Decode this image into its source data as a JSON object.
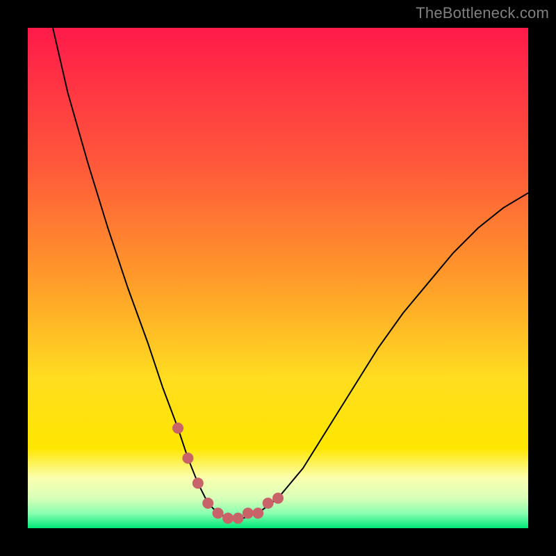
{
  "watermark": "TheBottleneck.com",
  "colors": {
    "bg_black": "#000000",
    "grad_top": "#ff1a4a",
    "grad_mid_orange": "#ff8a2a",
    "grad_yellow": "#ffe600",
    "grad_pale": "#f8ffb8",
    "grad_green": "#00e878",
    "curve": "#000000",
    "marker": "#c86469"
  },
  "chart_data": {
    "type": "line",
    "title": "",
    "xlabel": "",
    "ylabel": "",
    "xlim": [
      0,
      100
    ],
    "ylim": [
      0,
      100
    ],
    "grid": false,
    "legend": false,
    "series": [
      {
        "name": "bottleneck-curve",
        "x": [
          5,
          8,
          12,
          16,
          20,
          24,
          27,
          30,
          32,
          34,
          36,
          38,
          40,
          43,
          46,
          50,
          55,
          60,
          65,
          70,
          75,
          80,
          85,
          90,
          95,
          100
        ],
        "y": [
          100,
          87,
          73,
          60,
          48,
          37,
          28,
          20,
          14,
          9,
          5,
          3,
          2,
          2,
          3,
          6,
          12,
          20,
          28,
          36,
          43,
          49,
          55,
          60,
          64,
          67
        ]
      }
    ],
    "markers": {
      "name": "highlight-points",
      "x": [
        30,
        32,
        34,
        36,
        38,
        40,
        42,
        44,
        46,
        48,
        50
      ],
      "y": [
        20,
        14,
        9,
        5,
        3,
        2,
        2,
        3,
        3,
        5,
        6
      ]
    },
    "annotations": []
  }
}
